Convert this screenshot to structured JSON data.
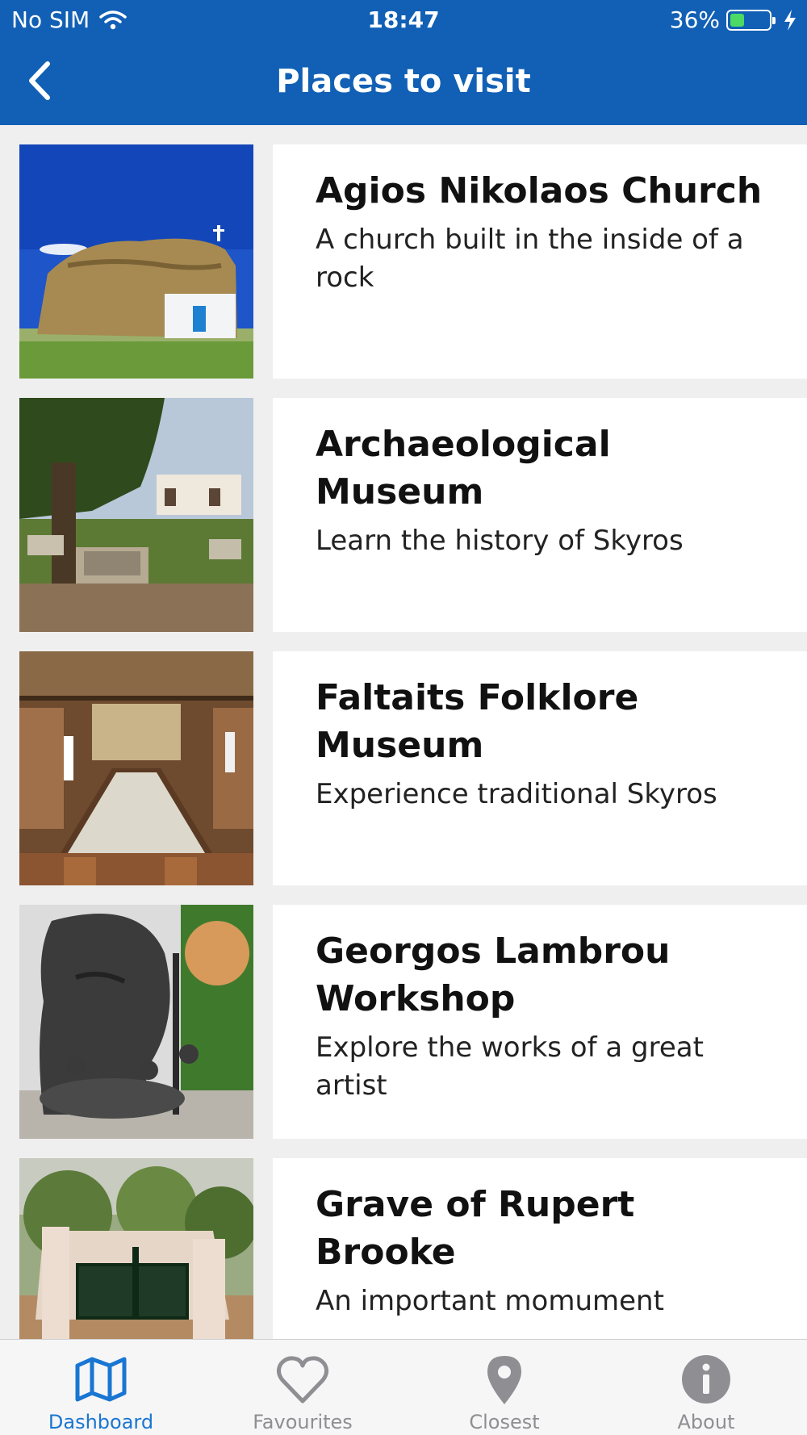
{
  "status_bar": {
    "carrier": "No SIM",
    "time": "18:47",
    "battery": "36%",
    "battery_level": 0.36
  },
  "header": {
    "title": "Places to visit"
  },
  "places": [
    {
      "title": "Agios Nikolaos Church",
      "description": "A church built in the inside of a rock"
    },
    {
      "title": "Archaeological Museum",
      "description": "Learn the history of Skyros"
    },
    {
      "title": "Faltaits Folklore Museum",
      "description": "Experience traditional Skyros"
    },
    {
      "title": "Georgos Lambrou Workshop",
      "description": "Explore the works of a great artist"
    },
    {
      "title": "Grave of Rupert Brooke",
      "description": "An important momument"
    }
  ],
  "tabs": [
    {
      "label": "Dashboard",
      "icon": "map-icon",
      "active": true
    },
    {
      "label": "Favourites",
      "icon": "heart-icon",
      "active": false
    },
    {
      "label": "Closest",
      "icon": "location-pin-icon",
      "active": false
    },
    {
      "label": "About",
      "icon": "info-icon",
      "active": false
    }
  ],
  "colors": {
    "header": "#1160b5",
    "active_tab": "#1976d2",
    "inactive_tab": "#8e8e93",
    "background": "#efefef"
  }
}
